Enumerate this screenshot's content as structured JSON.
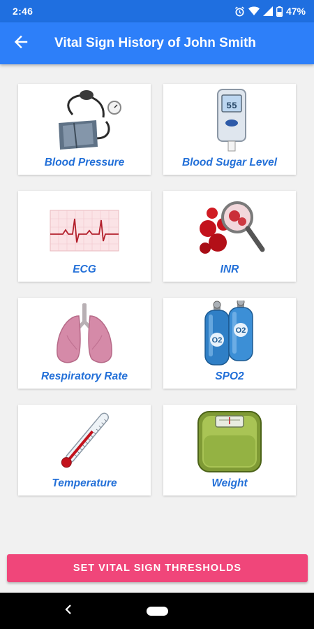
{
  "status_bar": {
    "time": "2:46",
    "battery_percent": "47%"
  },
  "app_bar": {
    "title": "Vital Sign History of John Smith",
    "back_icon": "arrow-left-icon"
  },
  "cards": [
    {
      "label": "Blood Pressure",
      "icon": "blood-pressure-monitor-icon"
    },
    {
      "label": "Blood Sugar Level",
      "icon": "glucose-meter-icon"
    },
    {
      "label": "ECG",
      "icon": "ecg-waveform-icon"
    },
    {
      "label": "INR",
      "icon": "blood-cells-magnifier-icon"
    },
    {
      "label": "Respiratory Rate",
      "icon": "lungs-icon"
    },
    {
      "label": "SPO2",
      "icon": "oxygen-tanks-icon"
    },
    {
      "label": "Temperature",
      "icon": "thermometer-icon"
    },
    {
      "label": "Weight",
      "icon": "weighing-scale-icon"
    }
  ],
  "glucose_meter_reading": "55",
  "oxygen_tank_label": "O2",
  "action_button": {
    "label": "SET VITAL SIGN THRESHOLDS"
  },
  "colors": {
    "primary": "#2d7ff9",
    "status_bar": "#1f6fe0",
    "accent": "#f0467a",
    "label_text": "#2370d8",
    "background": "#f1f1f1"
  }
}
